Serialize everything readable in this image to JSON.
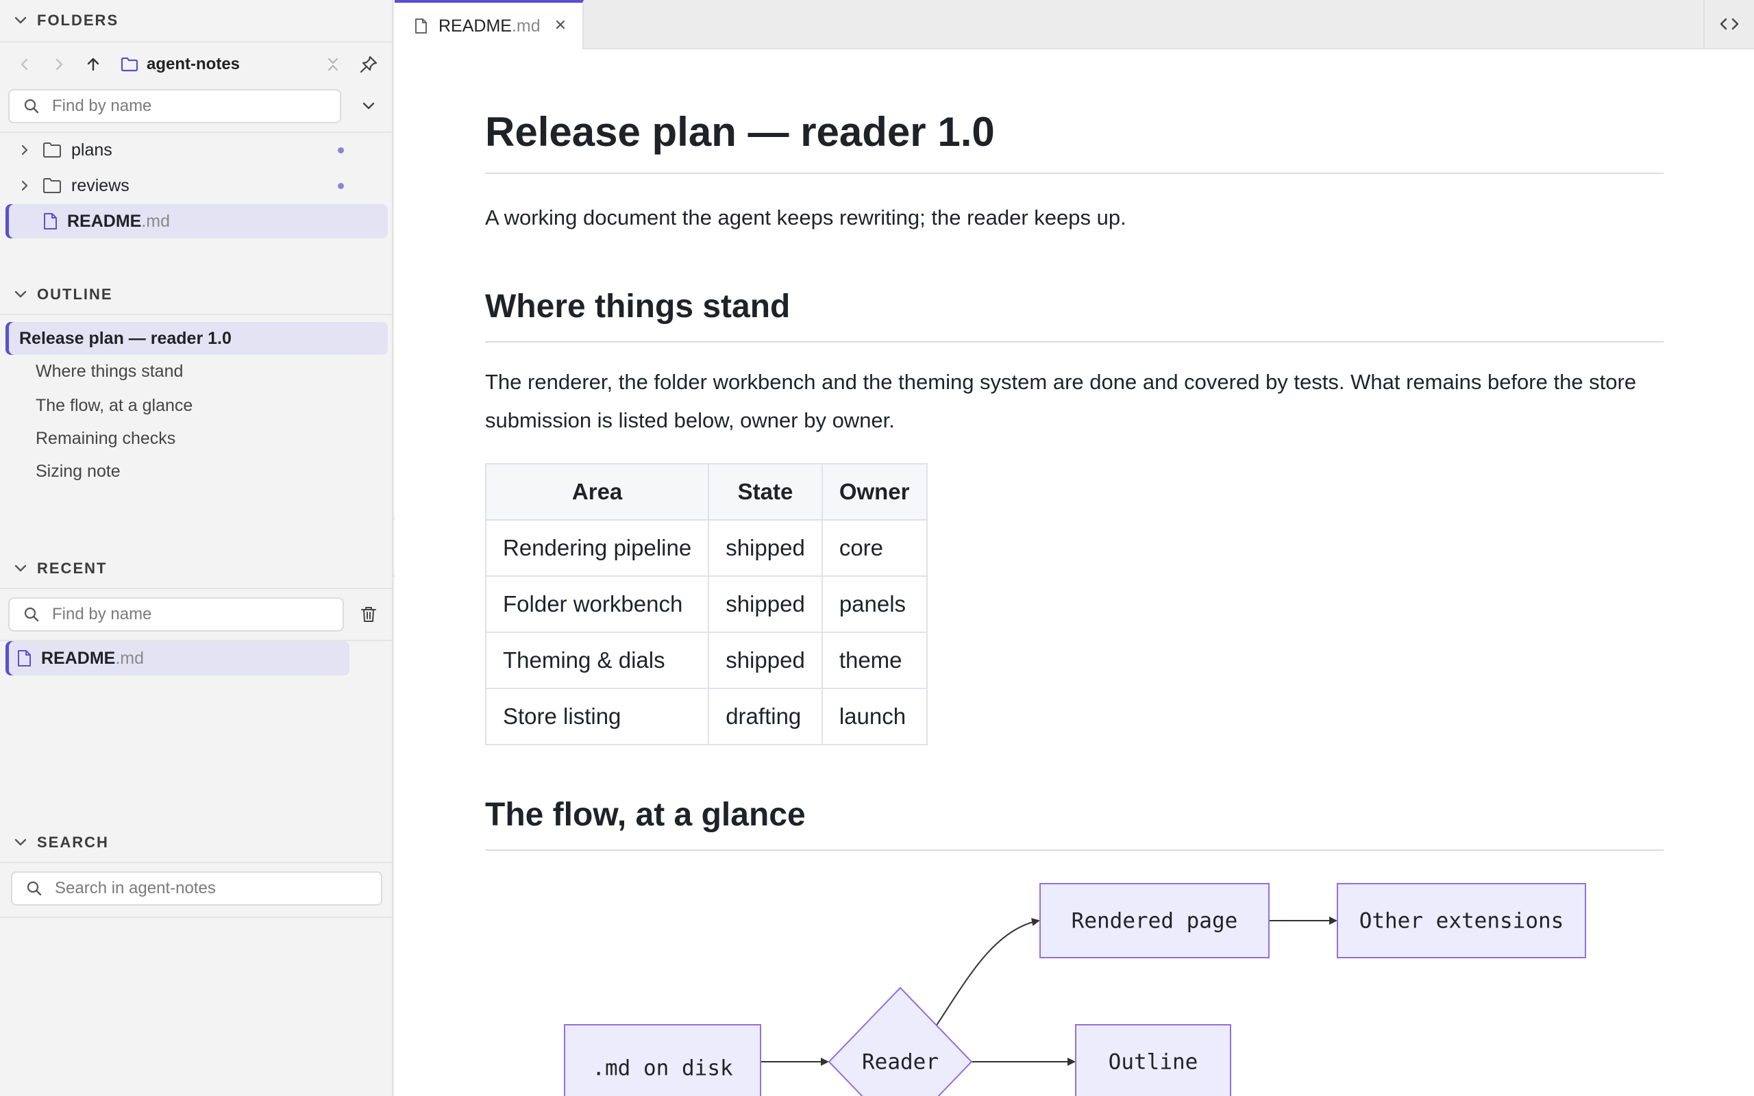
{
  "sidebar": {
    "folders": {
      "title": "FOLDERS",
      "current_folder": "agent-notes",
      "find_placeholder": "Find by name",
      "items": [
        {
          "name": "plans",
          "type": "folder"
        },
        {
          "name": "reviews",
          "type": "folder"
        }
      ],
      "file": {
        "base": "README",
        "ext": ".md"
      }
    },
    "outline": {
      "title": "OUTLINE",
      "items": [
        {
          "label": "Release plan — reader 1.0",
          "level": 1
        },
        {
          "label": "Where things stand",
          "level": 2
        },
        {
          "label": "The flow, at a glance",
          "level": 2
        },
        {
          "label": "Remaining checks",
          "level": 2
        },
        {
          "label": "Sizing note",
          "level": 2
        }
      ]
    },
    "recent": {
      "title": "RECENT",
      "find_placeholder": "Find by name",
      "file": {
        "base": "README",
        "ext": ".md"
      }
    },
    "search": {
      "title": "SEARCH",
      "placeholder": "Search in agent-notes"
    }
  },
  "tab": {
    "base": "README",
    "ext": ".md"
  },
  "document": {
    "h1": "Release plan — reader 1.0",
    "intro": "A working document the agent keeps rewriting; the reader keeps up.",
    "h2_status": "Where things stand",
    "status_para": "The renderer, the folder workbench and the theming system are done and covered by tests. What remains before the store submission is listed below, owner by owner.",
    "table": {
      "headers": [
        "Area",
        "State",
        "Owner"
      ],
      "rows": [
        [
          "Rendering pipeline",
          "shipped",
          "core"
        ],
        [
          "Folder workbench",
          "shipped",
          "panels"
        ],
        [
          "Theming & dials",
          "shipped",
          "theme"
        ],
        [
          "Store listing",
          "drafting",
          "launch"
        ]
      ]
    },
    "h2_flow": "The flow, at a glance",
    "flow": {
      "nodes": {
        "disk": ".md on disk",
        "reader": "Reader",
        "rendered": "Rendered page",
        "outline": "Outline",
        "other": "Other extensions"
      }
    }
  },
  "colors": {
    "accent": "#5a4fcf",
    "selection": "#e4e3f3",
    "node_fill": "#ececfd",
    "node_stroke": "#9370db"
  }
}
